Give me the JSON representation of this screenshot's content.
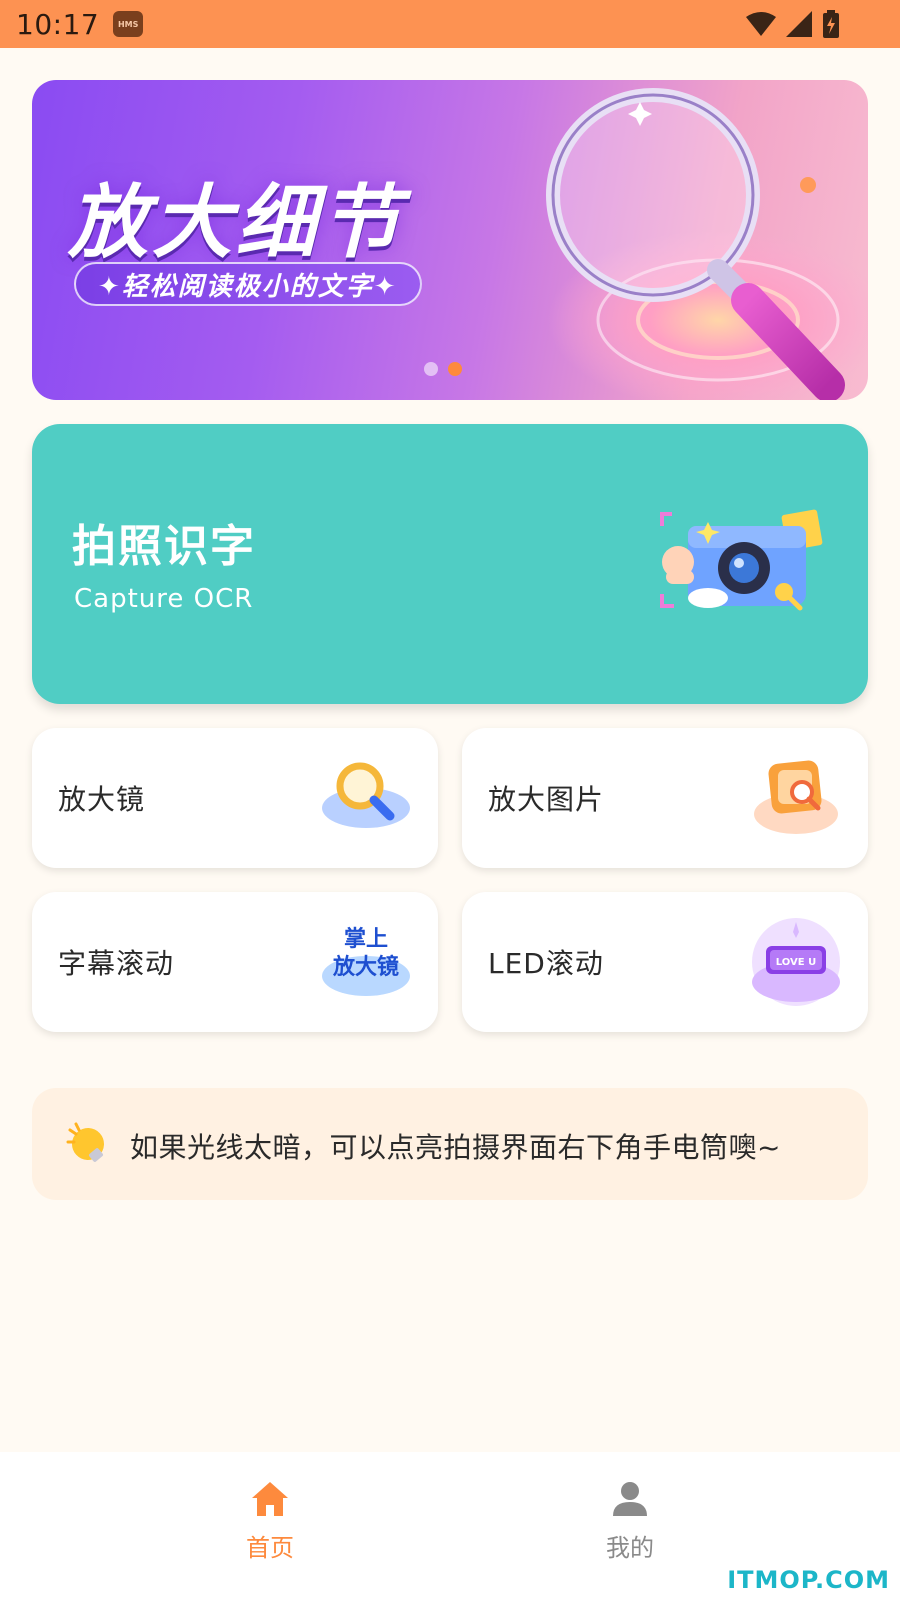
{
  "status_bar": {
    "time": "10:17",
    "badge": "HMS",
    "icons": [
      "wifi-icon",
      "signal-icon",
      "battery-charging-icon"
    ],
    "background": "#fd9252"
  },
  "banner": {
    "title": "放大细节",
    "subtitle": "✦轻松阅读极小的文字✦",
    "page_count": 2,
    "active_page": 2
  },
  "capture_card": {
    "title": "拍照识字",
    "subtitle": "Capture OCR",
    "color": "#50cdc4",
    "icon": "camera-icon"
  },
  "tools": [
    {
      "label": "放大镜",
      "icon": "magnifier-icon"
    },
    {
      "label": "放大图片",
      "icon": "image-zoom-icon"
    },
    {
      "label": "字幕滚动",
      "icon": "subtitle-scroll-icon",
      "icon_text": "掌上\n放大镜"
    },
    {
      "label": "LED滚动",
      "icon": "led-scroll-icon",
      "icon_text": "LOVE U"
    }
  ],
  "tip": {
    "icon": "lightbulb-icon",
    "text": "如果光线太暗，可以点亮拍摄界面右下角手电筒噢~"
  },
  "bottom_nav": {
    "items": [
      {
        "label": "首页",
        "icon": "home-icon",
        "active": true
      },
      {
        "label": "我的",
        "icon": "person-icon",
        "active": false
      }
    ],
    "accent": "#fd8a3d"
  },
  "watermark": "ITMOP.COM"
}
